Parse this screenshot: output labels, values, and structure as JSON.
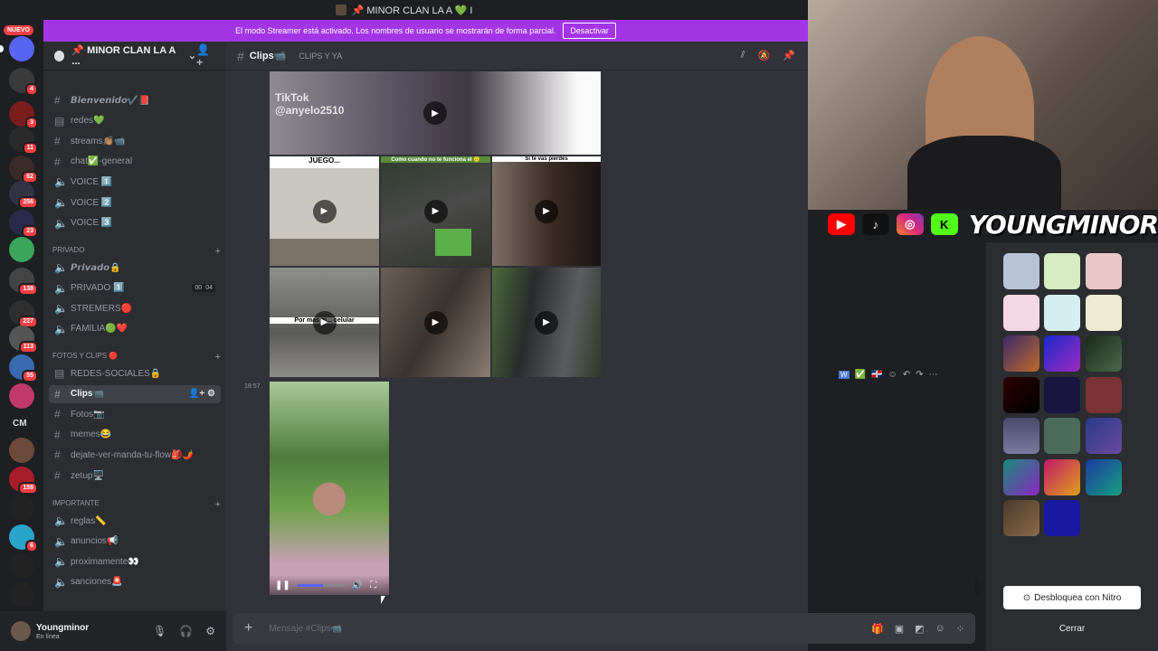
{
  "window": {
    "title": "📌 MINOR CLAN LA A 💚 I"
  },
  "streamer_bar": {
    "message": "El modo Streamer está activado. Los nombres de usuario se mostrarán de forma parcial.",
    "button": "Desactivar"
  },
  "servers": {
    "new_badge": "NUEVO",
    "badges": [
      "4",
      "3",
      "11",
      "62",
      "256",
      "23",
      "138",
      "227",
      "113",
      "55",
      "CM",
      "158",
      "6"
    ]
  },
  "guild": {
    "name": "📌 MINOR CLAN LA A ..."
  },
  "channels": {
    "top": [
      {
        "name": "𝘽𝙞𝙚𝙣𝙫𝙚𝙣𝙞𝙙𝙤✔️📕",
        "icon": "#"
      },
      {
        "name": "redes💚",
        "icon": "rules"
      },
      {
        "name": "streams👏🏽📹",
        "icon": "#"
      },
      {
        "name": "chat✅-general",
        "icon": "#"
      },
      {
        "name": "VOICE 1️⃣",
        "icon": "voice"
      },
      {
        "name": "VOICE 2️⃣",
        "icon": "voice"
      },
      {
        "name": "VOICE 3️⃣",
        "icon": "voice"
      }
    ],
    "cat_privado": "PRIVADO",
    "privado": [
      {
        "name": "𝙋𝙧𝙞𝙫𝙖𝙙𝙤🔒",
        "icon": "voice"
      },
      {
        "name": "PRIVADO 1️⃣",
        "icon": "voice",
        "count_a": "00",
        "count_b": "04"
      },
      {
        "name": "STREMERS🔴",
        "icon": "voice"
      },
      {
        "name": "FAMILIA🟢❤️",
        "icon": "voice"
      }
    ],
    "cat_fotos": "FOTOS Y CLIPS 🔴",
    "fotos": [
      {
        "name": "REDES-SOCIALES🔒",
        "icon": "rules"
      },
      {
        "name": "Clips📹",
        "icon": "#"
      },
      {
        "name": "Fotos📷",
        "icon": "#"
      },
      {
        "name": "memes😂",
        "icon": "#"
      },
      {
        "name": "dejate-ver-manda-tu-flow🎒🌶️",
        "icon": "#"
      },
      {
        "name": "zetup🖥️",
        "icon": "#"
      }
    ],
    "cat_importante": "IMPORTANTE",
    "importante": [
      {
        "name": "reglas📏",
        "icon": "voice"
      },
      {
        "name": "anuncios📢",
        "icon": "voice"
      },
      {
        "name": "proximamente👀",
        "icon": "voice"
      },
      {
        "name": "sanciones🚨",
        "icon": "voice"
      }
    ]
  },
  "user": {
    "name": "Youngminor",
    "status": "En línea"
  },
  "channel_header": {
    "name": "Clips📹",
    "topic": "CLIPS Y YA"
  },
  "media": {
    "top_watermark": "TikTok\n@anyelo2510",
    "juego": "JUEGO...",
    "como": "Como cuando no te funciona el 🙃",
    "si_te": "Si te vas pierdes",
    "celular": "Por mas m... celular",
    "time": "18:57",
    "progress": 0.55
  },
  "composer": {
    "placeholder": "Mensaje #Clips📹"
  },
  "overlay": {
    "streamer_name": "YOUNGMINOR"
  },
  "theme_panel": {
    "nitro_button": "Desbloquea con Nitro",
    "close_button": "Cerrar"
  },
  "colors": {
    "brand": "#5865f2",
    "streamer": "#a335e6",
    "active": "#404249",
    "badge": "#f23f43"
  }
}
